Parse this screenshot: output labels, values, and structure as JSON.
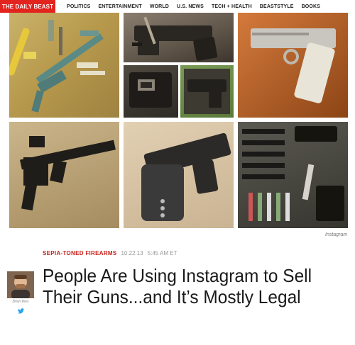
{
  "nav": {
    "logo": "THE DAILY BEAST",
    "items": [
      "POLITICS",
      "ENTERTAINMENT",
      "WORLD",
      "U.S. NEWS",
      "TECH + HEALTH",
      "BEASTSTYLE",
      "BOOKS"
    ]
  },
  "gallery": {
    "caption": "Instagram"
  },
  "article": {
    "section": "SEPIA-TONED FIREARMS",
    "date": "10.22.13",
    "time": "5:45 AM ET",
    "author": "Brian Ries",
    "headline": "People Are Using Instagram to Sell Their Guns...and It’s Mostly Legal"
  },
  "colors": {
    "brand_red": "#e2241f",
    "section_red": "#c8221b",
    "twitter_blue": "#2aa3ef"
  }
}
